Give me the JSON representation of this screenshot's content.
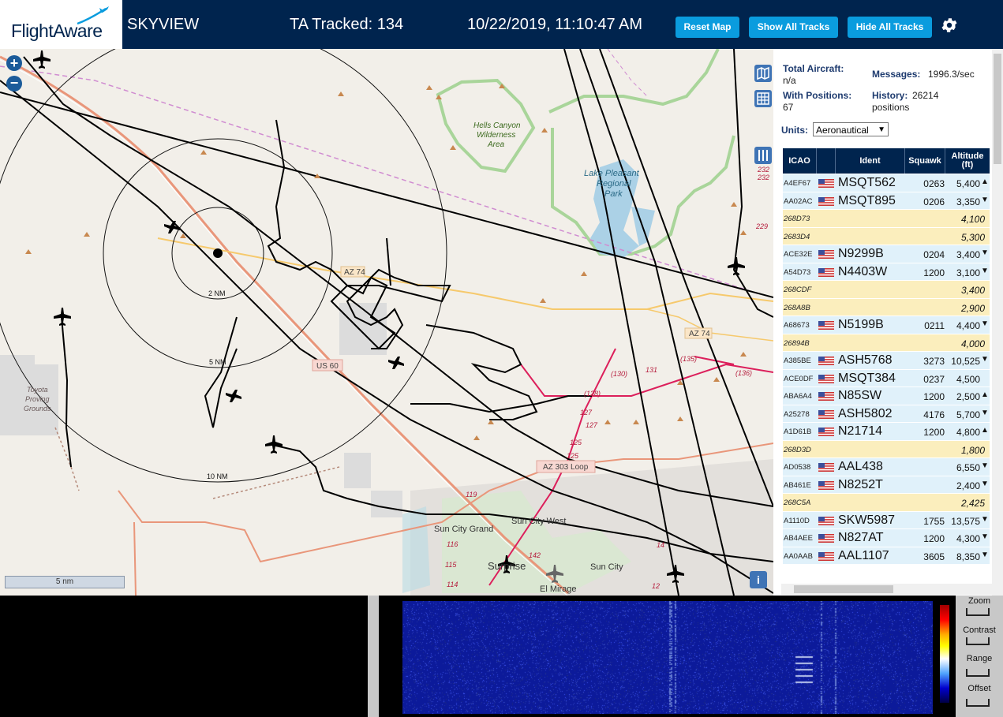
{
  "header": {
    "logo_text": "FlightAware",
    "app_title": "SKYVIEW",
    "ta_tracked": "TA Tracked: 134",
    "datetime": "10/22/2019, 11:10:47 AM",
    "reset_label": "Reset Map",
    "show_label": "Show All Tracks",
    "hide_label": "Hide All Tracks"
  },
  "map": {
    "zoom_in": "+",
    "zoom_out": "−",
    "ring_labels": [
      "2 NM",
      "5 NM",
      "10 NM"
    ],
    "place_labels": [
      "Hells Canyon",
      "Wilderness",
      "Area",
      "Lake Pleasant",
      "Regional",
      "Park",
      "Toyota",
      "Proving",
      "Grounds",
      "Sun City Grand",
      "Sun City West",
      "Sun City",
      "Surprise",
      "El Mirage"
    ],
    "road_labels": [
      "AZ 74",
      "AZ 74",
      "US 60",
      "AZ 303 Loop"
    ],
    "route_numbers": [
      "229",
      "232",
      "232",
      "(130)",
      "131",
      "(135)",
      "(136)",
      "(128)",
      "127",
      "127",
      "125",
      "125",
      "119",
      "116",
      "115",
      "114",
      "142",
      "14",
      "12"
    ],
    "scale": "5 nm",
    "info": "i"
  },
  "stats": {
    "total_aircraft_label": "Total Aircraft:",
    "total_aircraft_value": "n/a",
    "with_positions_label": "With Positions:",
    "with_positions_value": "67",
    "messages_label": "Messages:",
    "messages_value": "1996.3/sec",
    "history_label": "History:",
    "history_value": "26214",
    "history_unit": "positions"
  },
  "units": {
    "label": "Units:",
    "selected": "Aeronautical"
  },
  "table": {
    "headers": {
      "icao": "ICAO",
      "ident": "Ident",
      "squawk": "Squawk",
      "altitude": "Altitude",
      "altitude_unit": "(ft)"
    },
    "rows": [
      {
        "icao": "A4EF67",
        "flag": true,
        "ident": "MSQT562",
        "squawk": "0263",
        "altitude": "5,400",
        "trend": "▲",
        "positioned": true
      },
      {
        "icao": "AA02AC",
        "flag": true,
        "ident": "MSQT895",
        "squawk": "0206",
        "altitude": "3,350",
        "trend": "▼",
        "positioned": true
      },
      {
        "icao": "268D73",
        "flag": false,
        "ident": "",
        "squawk": "",
        "altitude": "4,100",
        "trend": "",
        "positioned": false
      },
      {
        "icao": "2683D4",
        "flag": false,
        "ident": "",
        "squawk": "",
        "altitude": "5,300",
        "trend": "",
        "positioned": false
      },
      {
        "icao": "ACE32E",
        "flag": true,
        "ident": "N9299B",
        "squawk": "0204",
        "altitude": "3,400",
        "trend": "▼",
        "positioned": true
      },
      {
        "icao": "A54D73",
        "flag": true,
        "ident": "N4403W",
        "squawk": "1200",
        "altitude": "3,100",
        "trend": "▼",
        "positioned": true
      },
      {
        "icao": "268CDF",
        "flag": false,
        "ident": "",
        "squawk": "",
        "altitude": "3,400",
        "trend": "",
        "positioned": false
      },
      {
        "icao": "268A8B",
        "flag": false,
        "ident": "",
        "squawk": "",
        "altitude": "2,900",
        "trend": "",
        "positioned": false
      },
      {
        "icao": "A68673",
        "flag": true,
        "ident": "N5199B",
        "squawk": "0211",
        "altitude": "4,400",
        "trend": "▼",
        "positioned": true
      },
      {
        "icao": "26894B",
        "flag": false,
        "ident": "",
        "squawk": "",
        "altitude": "4,000",
        "trend": "",
        "positioned": false
      },
      {
        "icao": "A385BE",
        "flag": true,
        "ident": "ASH5768",
        "squawk": "3273",
        "altitude": "10,525",
        "trend": "▼",
        "positioned": true
      },
      {
        "icao": "ACE0DF",
        "flag": true,
        "ident": "MSQT384",
        "squawk": "0237",
        "altitude": "4,500",
        "trend": "",
        "positioned": true
      },
      {
        "icao": "ABA6A4",
        "flag": true,
        "ident": "N85SW",
        "squawk": "1200",
        "altitude": "2,500",
        "trend": "▲",
        "positioned": true
      },
      {
        "icao": "A25278",
        "flag": true,
        "ident": "ASH5802",
        "squawk": "4176",
        "altitude": "5,700",
        "trend": "▼",
        "positioned": true
      },
      {
        "icao": "A1D61B",
        "flag": true,
        "ident": "N21714",
        "squawk": "1200",
        "altitude": "4,800",
        "trend": "▲",
        "positioned": true
      },
      {
        "icao": "268D3D",
        "flag": false,
        "ident": "",
        "squawk": "",
        "altitude": "1,800",
        "trend": "",
        "positioned": false
      },
      {
        "icao": "AD0538",
        "flag": true,
        "ident": "AAL438",
        "squawk": "",
        "altitude": "6,550",
        "trend": "▼",
        "positioned": true
      },
      {
        "icao": "AB461E",
        "flag": true,
        "ident": "N8252T",
        "squawk": "",
        "altitude": "2,400",
        "trend": "▼",
        "positioned": true
      },
      {
        "icao": "268C5A",
        "flag": false,
        "ident": "",
        "squawk": "",
        "altitude": "2,425",
        "trend": "",
        "positioned": false
      },
      {
        "icao": "A1110D",
        "flag": true,
        "ident": "SKW5987",
        "squawk": "1755",
        "altitude": "13,575",
        "trend": "▼",
        "positioned": true
      },
      {
        "icao": "AB4AEE",
        "flag": true,
        "ident": "N827AT",
        "squawk": "1200",
        "altitude": "4,300",
        "trend": "▼",
        "positioned": true
      },
      {
        "icao": "AA0AAB",
        "flag": true,
        "ident": "AAL1107",
        "squawk": "3605",
        "altitude": "8,350",
        "trend": "▼",
        "positioned": true
      }
    ]
  },
  "waterfall_controls": {
    "zoom": "Zoom",
    "contrast": "Contrast",
    "range": "Range",
    "offset": "Offset"
  },
  "colors": {
    "header_bg": "#00244e",
    "button_bg": "#0a9cde",
    "row_positioned": "#e0f1fa",
    "row_no_position": "#fbeebd",
    "waterfall_bg": "#0c1a9a"
  },
  "icons": [
    "flightaware-plane-icon",
    "gear-icon",
    "zoom-in-icon",
    "zoom-out-icon",
    "map-layer-icon",
    "grid-icon",
    "columns-icon",
    "info-icon",
    "us-flag-icon",
    "aircraft-icon"
  ]
}
